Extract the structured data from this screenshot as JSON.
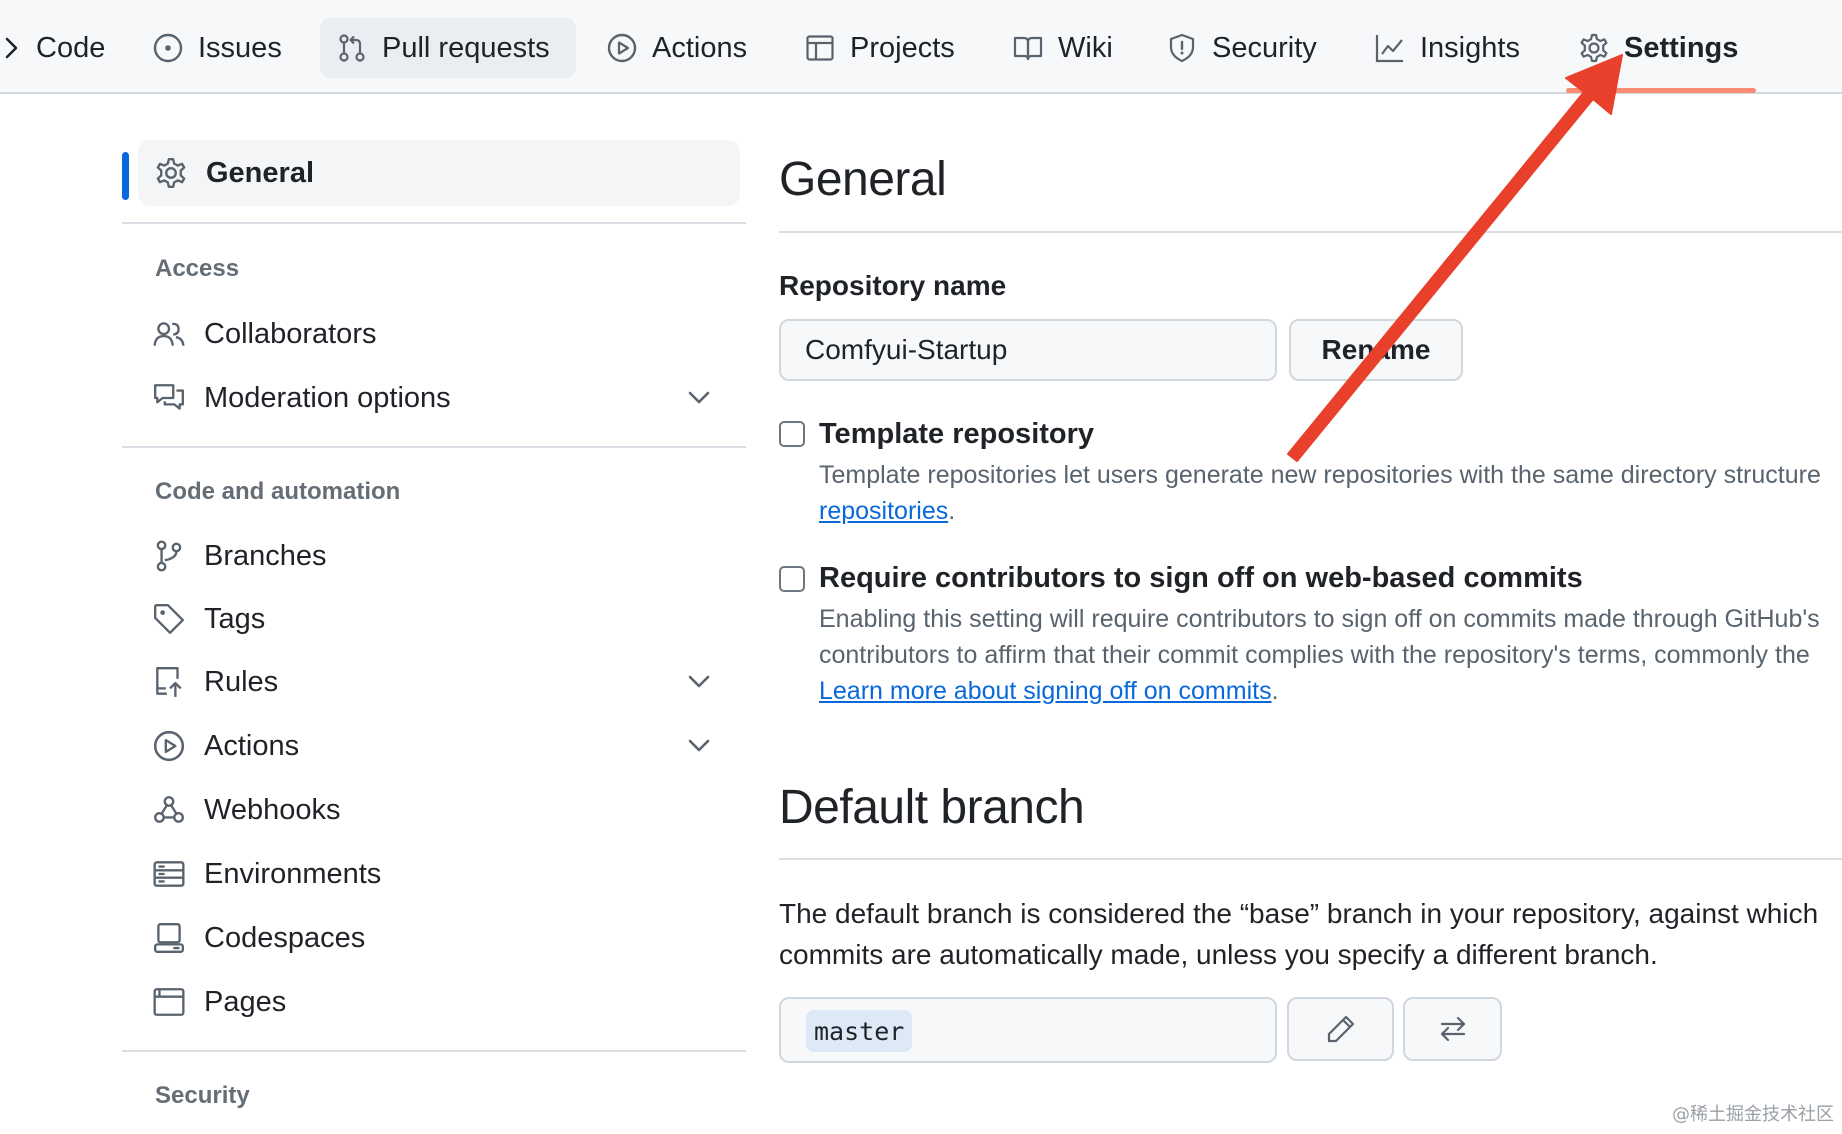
{
  "top_nav": {
    "items": [
      {
        "label": "Code",
        "icon": "code-icon"
      },
      {
        "label": "Issues",
        "icon": "issue-opened-icon"
      },
      {
        "label": "Pull requests",
        "icon": "git-pull-request-icon"
      },
      {
        "label": "Actions",
        "icon": "play-icon"
      },
      {
        "label": "Projects",
        "icon": "table-icon"
      },
      {
        "label": "Wiki",
        "icon": "book-icon"
      },
      {
        "label": "Security",
        "icon": "shield-icon"
      },
      {
        "label": "Insights",
        "icon": "graph-icon"
      },
      {
        "label": "Settings",
        "icon": "gear-icon"
      }
    ],
    "selected": "Settings",
    "accent_underline": "#fd8c73"
  },
  "sidebar": {
    "active": {
      "label": "General",
      "icon": "gear-icon"
    },
    "sections": [
      {
        "heading": "Access",
        "items": [
          {
            "label": "Collaborators",
            "icon": "people-icon"
          },
          {
            "label": "Moderation options",
            "icon": "comment-discussion-icon",
            "expandable": true
          }
        ]
      },
      {
        "heading": "Code and automation",
        "items": [
          {
            "label": "Branches",
            "icon": "git-branch-icon"
          },
          {
            "label": "Tags",
            "icon": "tag-icon"
          },
          {
            "label": "Rules",
            "icon": "repo-push-icon",
            "expandable": true
          },
          {
            "label": "Actions",
            "icon": "play-icon",
            "expandable": true
          },
          {
            "label": "Webhooks",
            "icon": "webhook-icon"
          },
          {
            "label": "Environments",
            "icon": "server-icon"
          },
          {
            "label": "Codespaces",
            "icon": "codespaces-icon"
          },
          {
            "label": "Pages",
            "icon": "browser-icon"
          }
        ]
      },
      {
        "heading": "Security",
        "items": []
      }
    ],
    "accent": "#0969da"
  },
  "main": {
    "general_title": "General",
    "repo_name_label": "Repository name",
    "repo_name_value": "Comfyui-Startup",
    "rename_button": "Rename",
    "template": {
      "title": "Template repository",
      "desc_line1": "Template repositories let users generate new repositories with the same directory structure",
      "link": "repositories",
      "suffix": "."
    },
    "signoff": {
      "title": "Require contributors to sign off on web-based commits",
      "desc_line1": "Enabling this setting will require contributors to sign off on commits made through GitHub's",
      "desc_line2": "contributors to affirm that their commit complies with the repository's terms, commonly the",
      "link": "Learn more about signing off on commits",
      "suffix": "."
    },
    "default_branch_title": "Default branch",
    "default_branch_line1": "The default branch is considered the “base” branch in your repository, against which",
    "default_branch_line2": "commits are automatically made, unless you specify a different branch.",
    "branch_name": "master",
    "edit_icon": "pencil-icon",
    "switch_icon": "arrow-switch-icon"
  },
  "annotation": {
    "arrow_color": "#e8402a",
    "points_to": "Settings"
  },
  "watermark": "@稀土掘金技术社区"
}
